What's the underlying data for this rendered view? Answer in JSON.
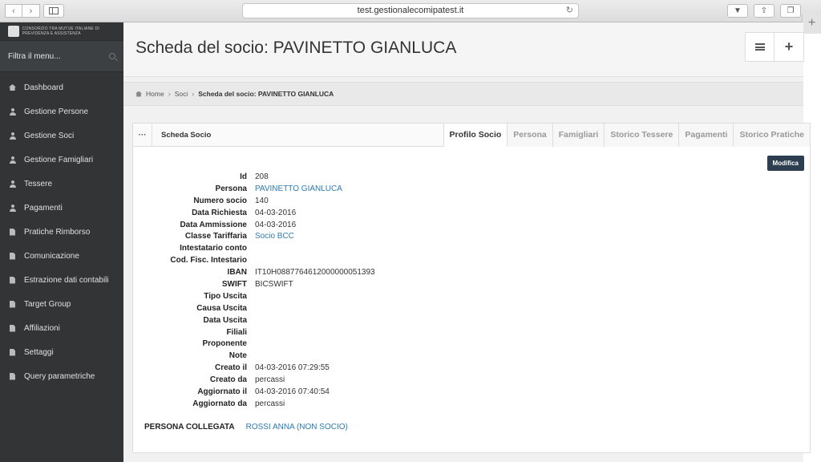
{
  "browser": {
    "url": "test.gestionalecomipatest.it"
  },
  "sidebar": {
    "logo_text": "CONSORZIO TRA MUTUE ITALIANE DI PREVIDENZA E ASSISTENZA",
    "filter_placeholder": "Filtra il menu...",
    "items": [
      {
        "label": "Dashboard",
        "icon": "home-icon"
      },
      {
        "label": "Gestione Persone",
        "icon": "user-icon"
      },
      {
        "label": "Gestione Soci",
        "icon": "user-icon"
      },
      {
        "label": "Gestione Famigliari",
        "icon": "user-icon"
      },
      {
        "label": "Tessere",
        "icon": "user-icon"
      },
      {
        "label": "Pagamenti",
        "icon": "user-icon"
      },
      {
        "label": "Pratiche Rimborso",
        "icon": "document-icon"
      },
      {
        "label": "Comunicazione",
        "icon": "document-icon"
      },
      {
        "label": "Estrazione dati contabili",
        "icon": "document-icon"
      },
      {
        "label": "Target Group",
        "icon": "document-icon"
      },
      {
        "label": "Affiliazioni",
        "icon": "document-icon"
      },
      {
        "label": "Settaggi",
        "icon": "document-icon"
      },
      {
        "label": "Query parametriche",
        "icon": "document-icon"
      }
    ]
  },
  "header": {
    "title": "Scheda del socio: PAVINETTO GIANLUCA"
  },
  "breadcrumb": {
    "home": "Home",
    "soci": "Soci",
    "current": "Scheda del socio: PAVINETTO GIANLUCA"
  },
  "panel": {
    "dots": "···",
    "title": "Scheda Socio",
    "tabs": [
      "Profilo Socio",
      "Persona",
      "Famigliari",
      "Storico Tessere",
      "Pagamenti",
      "Storico Pratiche"
    ],
    "active_tab": "Profilo Socio",
    "edit_button": "Modifica",
    "fields": [
      {
        "label": "Id",
        "value": "208",
        "link": false
      },
      {
        "label": "Persona",
        "value": "PAVINETTO GIANLUCA",
        "link": true
      },
      {
        "label": "Numero socio",
        "value": "140",
        "link": false
      },
      {
        "label": "Data Richiesta",
        "value": "04-03-2016",
        "link": false
      },
      {
        "label": "Data Ammissione",
        "value": "04-03-2016",
        "link": false
      },
      {
        "label": "Classe Tariffaria",
        "value": "Socio BCC",
        "link": true
      },
      {
        "label": "Intestatario conto",
        "value": "",
        "link": false
      },
      {
        "label": "Cod. Fisc. Intestario",
        "value": "",
        "link": false
      },
      {
        "label": "IBAN",
        "value": "IT10H0887764612000000051393",
        "link": false
      },
      {
        "label": "SWIFT",
        "value": "BICSWIFT",
        "link": false
      },
      {
        "label": "Tipo Uscita",
        "value": "",
        "link": false
      },
      {
        "label": "Causa Uscita",
        "value": "",
        "link": false
      },
      {
        "label": "Data Uscita",
        "value": "",
        "link": false
      },
      {
        "label": "Filiali",
        "value": "",
        "link": false
      },
      {
        "label": "Proponente",
        "value": "",
        "link": false
      },
      {
        "label": "Note",
        "value": "",
        "link": false
      },
      {
        "label": "Creato il",
        "value": "04-03-2016 07:29:55",
        "link": false
      },
      {
        "label": "Creato da",
        "value": "percassi",
        "link": false
      },
      {
        "label": "Aggiornato il",
        "value": "04-03-2016 07:40:54",
        "link": false
      },
      {
        "label": "Aggiornato da",
        "value": "percassi",
        "link": false
      }
    ],
    "linked_label": "PERSONA COLLEGATA",
    "linked_value": "ROSSI ANNA (NON SOCIO)"
  }
}
